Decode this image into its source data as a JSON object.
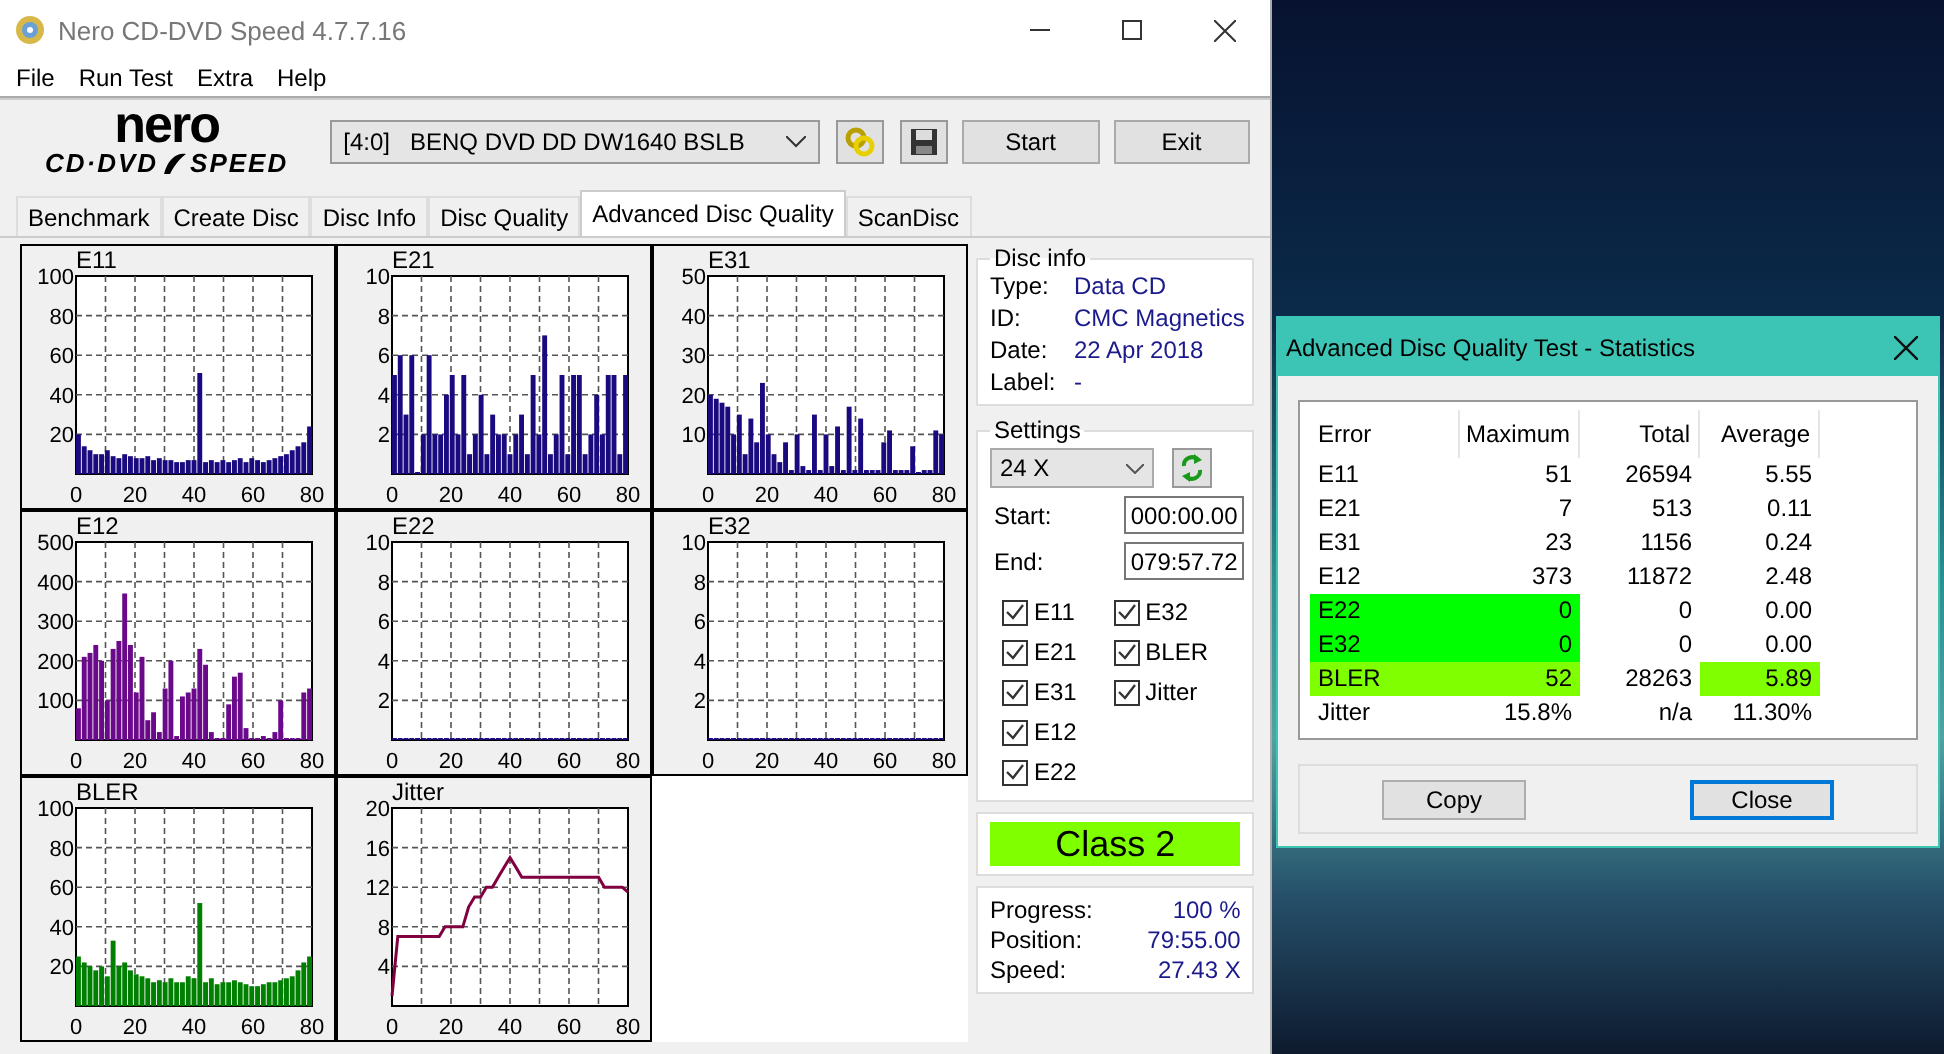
{
  "window": {
    "title": "Nero CD-DVD Speed 4.7.7.16"
  },
  "menu": [
    "File",
    "Run Test",
    "Extra",
    "Help"
  ],
  "logo": {
    "top": "nero",
    "left": "CD·DVD",
    "right": "SPEED"
  },
  "toolbar": {
    "drive": "[4:0]   BENQ DVD DD DW1640 BSLB",
    "start": "Start",
    "exit": "Exit"
  },
  "tabs": [
    {
      "label": "Benchmark",
      "selected": false
    },
    {
      "label": "Create Disc",
      "selected": false
    },
    {
      "label": "Disc Info",
      "selected": false
    },
    {
      "label": "Disc Quality",
      "selected": false
    },
    {
      "label": "Advanced Disc Quality",
      "selected": true
    },
    {
      "label": "ScanDisc",
      "selected": false
    }
  ],
  "charts": [
    {
      "chart_data": {
        "type": "bar",
        "title": "E11",
        "grid": true,
        "xlim": [
          0,
          80
        ],
        "ylim": [
          0,
          100
        ],
        "xticks": [
          0,
          20,
          40,
          60,
          80
        ],
        "yticks": [
          20,
          40,
          60,
          80,
          100
        ],
        "x": [
          0,
          2,
          4,
          6,
          8,
          10,
          12,
          14,
          16,
          18,
          20,
          22,
          24,
          26,
          28,
          30,
          32,
          34,
          36,
          38,
          40,
          42,
          44,
          46,
          48,
          50,
          52,
          54,
          56,
          58,
          60,
          62,
          64,
          66,
          68,
          70,
          72,
          74,
          76,
          78,
          80
        ],
        "series": [
          {
            "color": "#1a0a80",
            "values": [
              20,
              14,
              12,
              10,
              10,
              12,
              9,
              8,
              10,
              9,
              8,
              8,
              9,
              7,
              8,
              7,
              7,
              6,
              6,
              7,
              7,
              51,
              6,
              7,
              6,
              7,
              6,
              7,
              8,
              6,
              8,
              7,
              6,
              7,
              8,
              9,
              10,
              12,
              14,
              16,
              24
            ]
          }
        ]
      }
    },
    {
      "chart_data": {
        "type": "bar",
        "title": "E21",
        "grid": true,
        "xlim": [
          0,
          80
        ],
        "ylim": [
          0,
          10
        ],
        "xticks": [
          0,
          20,
          40,
          60,
          80
        ],
        "yticks": [
          2,
          4,
          6,
          8,
          10
        ],
        "x": [
          0,
          2,
          4,
          6,
          8,
          10,
          12,
          14,
          16,
          18,
          20,
          22,
          24,
          26,
          28,
          30,
          32,
          34,
          36,
          38,
          40,
          42,
          44,
          46,
          48,
          50,
          52,
          54,
          56,
          58,
          60,
          62,
          64,
          66,
          68,
          70,
          72,
          74,
          76,
          78,
          80
        ],
        "series": [
          {
            "color": "#1a0a80",
            "values": [
              5,
              6,
              3,
              6,
              0,
              2,
              6,
              2,
              2,
              4,
              5,
              2,
              5,
              1,
              2,
              4,
              1,
              3,
              2,
              2,
              1,
              2,
              3,
              1,
              5,
              2,
              7,
              1,
              2,
              5,
              1,
              5,
              5,
              1,
              2,
              4,
              2,
              5,
              5,
              1,
              5
            ]
          }
        ]
      }
    },
    {
      "chart_data": {
        "type": "bar",
        "title": "E31",
        "grid": true,
        "xlim": [
          0,
          80
        ],
        "ylim": [
          0,
          50
        ],
        "xticks": [
          0,
          20,
          40,
          60,
          80
        ],
        "yticks": [
          10,
          20,
          30,
          40,
          50
        ],
        "x": [
          0,
          2,
          4,
          6,
          8,
          10,
          12,
          14,
          16,
          18,
          20,
          22,
          24,
          26,
          28,
          30,
          32,
          34,
          36,
          38,
          40,
          42,
          44,
          46,
          48,
          50,
          52,
          54,
          56,
          58,
          60,
          62,
          64,
          66,
          68,
          70,
          72,
          74,
          76,
          78,
          80
        ],
        "series": [
          {
            "color": "#1a0a80",
            "values": [
              20,
              19,
              18,
              17,
              10,
              15,
              5,
              14,
              8,
              23,
              10,
              5,
              3,
              8,
              1,
              10,
              2,
              1,
              15,
              1,
              10,
              2,
              12,
              1,
              17,
              1,
              14,
              1,
              1,
              1,
              8,
              11,
              1,
              1,
              1,
              7,
              0,
              1,
              1,
              11,
              10
            ]
          }
        ]
      }
    },
    {
      "chart_data": {
        "type": "bar",
        "title": "E12",
        "grid": true,
        "xlim": [
          0,
          80
        ],
        "ylim": [
          0,
          500
        ],
        "xticks": [
          0,
          20,
          40,
          60,
          80
        ],
        "yticks": [
          100,
          200,
          300,
          400,
          500
        ],
        "x": [
          0,
          2,
          4,
          6,
          8,
          10,
          12,
          14,
          16,
          18,
          20,
          22,
          24,
          26,
          28,
          30,
          32,
          34,
          36,
          38,
          40,
          42,
          44,
          46,
          48,
          50,
          52,
          54,
          56,
          58,
          60,
          62,
          64,
          66,
          68,
          70,
          72,
          74,
          76,
          78,
          80
        ],
        "series": [
          {
            "color": "#6a0a8a",
            "values": [
              80,
              210,
              220,
              240,
              200,
              100,
              230,
              250,
              370,
              240,
              120,
              210,
              50,
              70,
              20,
              130,
              200,
              10,
              110,
              120,
              130,
              230,
              190,
              20,
              0,
              0,
              90,
              160,
              170,
              30,
              0,
              0,
              10,
              0,
              20,
              100,
              0,
              0,
              0,
              120,
              130
            ]
          }
        ]
      }
    },
    {
      "chart_data": {
        "type": "bar",
        "title": "E22",
        "grid": true,
        "xlim": [
          0,
          80
        ],
        "ylim": [
          0,
          10
        ],
        "xticks": [
          0,
          20,
          40,
          60,
          80
        ],
        "yticks": [
          2,
          4,
          6,
          8,
          10
        ],
        "x": [
          0,
          2,
          4,
          6,
          8,
          10,
          12,
          14,
          16,
          18,
          20,
          22,
          24,
          26,
          28,
          30,
          32,
          34,
          36,
          38,
          40,
          42,
          44,
          46,
          48,
          50,
          52,
          54,
          56,
          58,
          60,
          62,
          64,
          66,
          68,
          70,
          72,
          74,
          76,
          78,
          80
        ],
        "series": [
          {
            "color": "#1a0a80",
            "values": [
              0,
              0,
              0,
              0,
              0,
              0,
              0,
              0,
              0,
              0,
              0,
              0,
              0,
              0,
              0,
              0,
              0,
              0,
              0,
              0,
              0,
              0,
              0,
              0,
              0,
              0,
              0,
              0,
              0,
              0,
              0,
              0,
              0,
              0,
              0,
              0,
              0,
              0,
              0,
              0,
              0
            ]
          }
        ]
      }
    },
    {
      "chart_data": {
        "type": "bar",
        "title": "E32",
        "grid": true,
        "xlim": [
          0,
          80
        ],
        "ylim": [
          0,
          10
        ],
        "xticks": [
          0,
          20,
          40,
          60,
          80
        ],
        "yticks": [
          2,
          4,
          6,
          8,
          10
        ],
        "x": [
          0,
          2,
          4,
          6,
          8,
          10,
          12,
          14,
          16,
          18,
          20,
          22,
          24,
          26,
          28,
          30,
          32,
          34,
          36,
          38,
          40,
          42,
          44,
          46,
          48,
          50,
          52,
          54,
          56,
          58,
          60,
          62,
          64,
          66,
          68,
          70,
          72,
          74,
          76,
          78,
          80
        ],
        "series": [
          {
            "color": "#1a0a80",
            "values": [
              0,
              0,
              0,
              0,
              0,
              0,
              0,
              0,
              0,
              0,
              0,
              0,
              0,
              0,
              0,
              0,
              0,
              0,
              0,
              0,
              0,
              0,
              0,
              0,
              0,
              0,
              0,
              0,
              0,
              0,
              0,
              0,
              0,
              0,
              0,
              0,
              0,
              0,
              0,
              0,
              0
            ]
          }
        ]
      }
    },
    {
      "chart_data": {
        "type": "bar",
        "title": "BLER",
        "grid": true,
        "xlim": [
          0,
          80
        ],
        "ylim": [
          0,
          100
        ],
        "xticks": [
          0,
          20,
          40,
          60,
          80
        ],
        "yticks": [
          20,
          40,
          60,
          80,
          100
        ],
        "x": [
          0,
          2,
          4,
          6,
          8,
          10,
          12,
          14,
          16,
          18,
          20,
          22,
          24,
          26,
          28,
          30,
          32,
          34,
          36,
          38,
          40,
          42,
          44,
          46,
          48,
          50,
          52,
          54,
          56,
          58,
          60,
          62,
          64,
          66,
          68,
          70,
          72,
          74,
          76,
          78,
          80
        ],
        "series": [
          {
            "color": "#008000",
            "values": [
              25,
              22,
              20,
              18,
              20,
              15,
              33,
              20,
              22,
              18,
              16,
              15,
              14,
              12,
              13,
              12,
              14,
              12,
              12,
              15,
              14,
              52,
              12,
              14,
              11,
              12,
              12,
              13,
              12,
              11,
              10,
              10,
              11,
              12,
              12,
              13,
              14,
              15,
              18,
              22,
              25
            ]
          }
        ]
      }
    },
    {
      "chart_data": {
        "type": "line",
        "title": "Jitter",
        "grid": true,
        "xlim": [
          0,
          80
        ],
        "ylim": [
          0,
          20
        ],
        "xticks": [
          0,
          20,
          40,
          60,
          80
        ],
        "yticks": [
          4,
          8,
          12,
          16,
          20
        ],
        "x": [
          0,
          2,
          4,
          6,
          8,
          10,
          12,
          14,
          16,
          18,
          20,
          22,
          24,
          26,
          28,
          30,
          32,
          34,
          36,
          38,
          40,
          42,
          44,
          46,
          48,
          50,
          52,
          54,
          56,
          58,
          60,
          62,
          64,
          66,
          68,
          70,
          72,
          74,
          76,
          78,
          80
        ],
        "series": [
          {
            "color": "#800040",
            "values": [
              1,
              7,
              7,
              7,
              7,
              7,
              7,
              7,
              7,
              8,
              8,
              8,
              8,
              10,
              11,
              11,
              12,
              12,
              13,
              14,
              15,
              14,
              13,
              13,
              13,
              13,
              13,
              13,
              13,
              13,
              13,
              13,
              13,
              13,
              13,
              13,
              12,
              12,
              12,
              12,
              11.5
            ]
          }
        ]
      }
    }
  ],
  "disc_info": {
    "title": "Disc info",
    "rows": [
      {
        "label": "Type:",
        "value": "Data CD"
      },
      {
        "label": "ID:",
        "value": "CMC Magnetics"
      },
      {
        "label": "Date:",
        "value": "22 Apr 2018"
      },
      {
        "label": "Label:",
        "value": "-"
      }
    ]
  },
  "settings": {
    "title": "Settings",
    "speed": "24 X",
    "start_label": "Start:",
    "start": "000:00.00",
    "end_label": "End:",
    "end": "079:57.72",
    "checks": [
      {
        "label": "E11",
        "checked": true
      },
      {
        "label": "E21",
        "checked": true
      },
      {
        "label": "E31",
        "checked": true
      },
      {
        "label": "E12",
        "checked": true
      },
      {
        "label": "E22",
        "checked": true
      },
      {
        "label": "E32",
        "checked": true
      },
      {
        "label": "BLER",
        "checked": true
      },
      {
        "label": "Jitter",
        "checked": true
      }
    ]
  },
  "quality_class": "Class 2",
  "progress": [
    {
      "label": "Progress:",
      "value": "100 %"
    },
    {
      "label": "Position:",
      "value": "79:55.00"
    },
    {
      "label": "Speed:",
      "value": "27.43 X"
    }
  ],
  "stats_dialog": {
    "title": "Advanced Disc Quality Test - Statistics",
    "columns": [
      "Error",
      "Maximum",
      "Total",
      "Average"
    ],
    "rows": [
      {
        "cells": [
          {
            "text": "E11"
          },
          {
            "text": "51"
          },
          {
            "text": "26594"
          },
          {
            "text": "5.55"
          }
        ]
      },
      {
        "cells": [
          {
            "text": "E21"
          },
          {
            "text": "7"
          },
          {
            "text": "513"
          },
          {
            "text": "0.11"
          }
        ]
      },
      {
        "cells": [
          {
            "text": "E31"
          },
          {
            "text": "23"
          },
          {
            "text": "1156"
          },
          {
            "text": "0.24"
          }
        ]
      },
      {
        "cells": [
          {
            "text": "E12"
          },
          {
            "text": "373"
          },
          {
            "text": "11872"
          },
          {
            "text": "2.48"
          }
        ]
      },
      {
        "cells": [
          {
            "text": "E22",
            "color": "#00ff00"
          },
          {
            "text": "0",
            "color": "#00ff00"
          },
          {
            "text": "0"
          },
          {
            "text": "0.00"
          }
        ]
      },
      {
        "cells": [
          {
            "text": "E32",
            "color": "#00ff00"
          },
          {
            "text": "0",
            "color": "#00ff00"
          },
          {
            "text": "0"
          },
          {
            "text": "0.00"
          }
        ]
      },
      {
        "cells": [
          {
            "text": "BLER",
            "color": "#80ff00"
          },
          {
            "text": "52",
            "color": "#80ff00"
          },
          {
            "text": "28263"
          },
          {
            "text": "5.89",
            "color": "#80ff00"
          }
        ]
      },
      {
        "cells": [
          {
            "text": "Jitter"
          },
          {
            "text": "15.8%"
          },
          {
            "text": "n/a"
          },
          {
            "text": "11.30%"
          }
        ]
      }
    ],
    "buttons": [
      {
        "label": "Copy",
        "default": false
      },
      {
        "label": "Close",
        "default": true
      }
    ]
  }
}
